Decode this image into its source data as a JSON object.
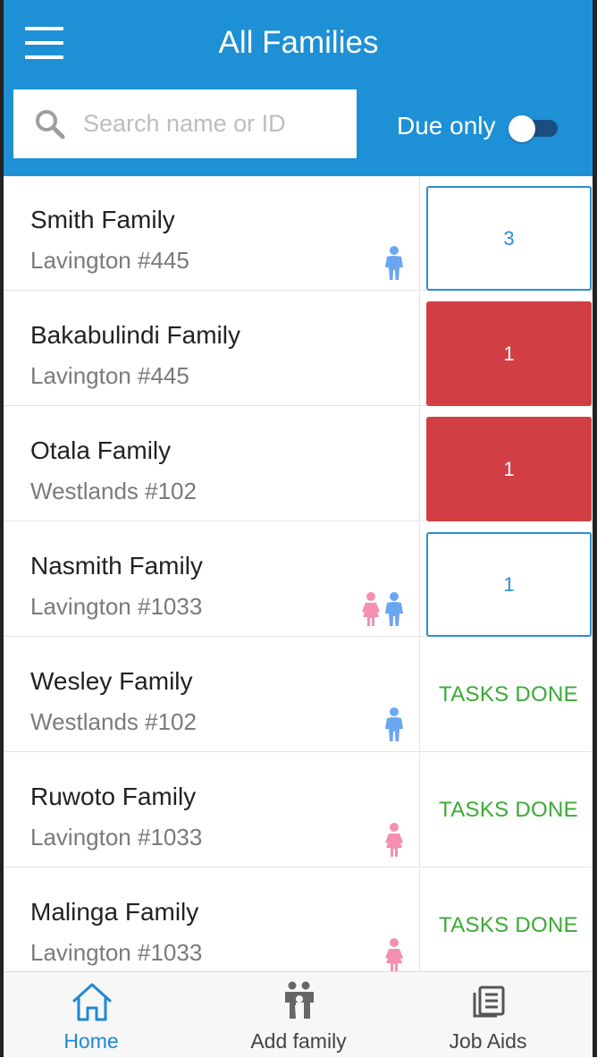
{
  "header": {
    "title": "All Families",
    "search_placeholder": "Search name or ID",
    "due_only_label": "Due only",
    "due_only_enabled": false
  },
  "families": [
    {
      "name": "Smith Family",
      "location": "Lavington #445",
      "children": [
        "boy"
      ],
      "status": "pending",
      "count": "3"
    },
    {
      "name": "Bakabulindi Family",
      "location": "Lavington #445",
      "children": [],
      "status": "overdue",
      "count": "1"
    },
    {
      "name": "Otala Family",
      "location": "Westlands #102",
      "children": [],
      "status": "overdue",
      "count": "1"
    },
    {
      "name": "Nasmith Family",
      "location": "Lavington #1033",
      "children": [
        "girl",
        "boy"
      ],
      "status": "pending",
      "count": "1"
    },
    {
      "name": "Wesley Family",
      "location": "Westlands #102",
      "children": [
        "boy"
      ],
      "status": "done",
      "count": "TASKS DONE"
    },
    {
      "name": "Ruwoto Family",
      "location": "Lavington #1033",
      "children": [
        "girl"
      ],
      "status": "done",
      "count": "TASKS DONE"
    },
    {
      "name": "Malinga Family",
      "location": "Lavington #1033",
      "children": [
        "girl"
      ],
      "status": "done",
      "count": "TASKS DONE"
    }
  ],
  "colors": {
    "header": "#1e90d6",
    "overdue": "#d13f45",
    "pending_outline": "#2a8fd6",
    "done_text": "#3aaa35",
    "boy_icon": "#6aa6f2",
    "girl_icon": "#f48fb1"
  },
  "bottom_nav": [
    {
      "label": "Home",
      "icon": "home-icon",
      "active": true
    },
    {
      "label": "Add family",
      "icon": "add-family-icon",
      "active": false
    },
    {
      "label": "Job Aids",
      "icon": "job-aids-icon",
      "active": false
    }
  ]
}
